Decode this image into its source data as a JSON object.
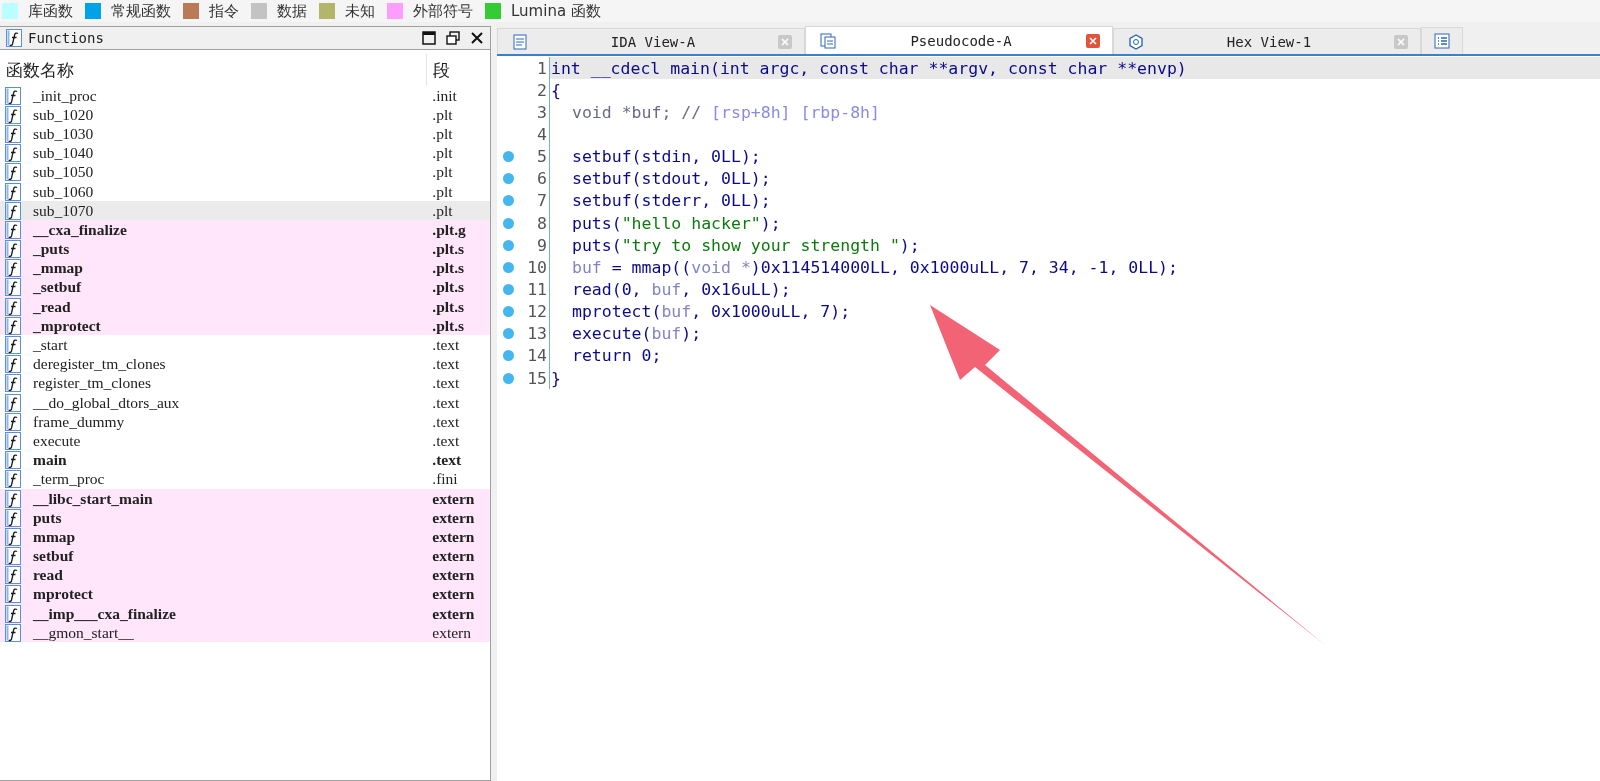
{
  "legend": [
    {
      "label": "库函数",
      "color": "#b9ffff"
    },
    {
      "label": "常规函数",
      "color": "#00a2e8"
    },
    {
      "label": "指令",
      "color": "#b97a57"
    },
    {
      "label": "数据",
      "color": "#c3c3c3"
    },
    {
      "label": "未知",
      "color": "#b5b56a"
    },
    {
      "label": "外部符号",
      "color": "#ff9dff"
    },
    {
      "label": "Lumina 函数",
      "color": "#33cc33"
    }
  ],
  "functions_panel": {
    "title": "Functions",
    "columns": [
      "函数名称",
      "段"
    ],
    "rows": [
      {
        "name": "_init_proc",
        "segment": ".init",
        "kind": "regular",
        "bold": false,
        "selected": false
      },
      {
        "name": "sub_1020",
        "segment": ".plt",
        "kind": "regular",
        "bold": false,
        "selected": false
      },
      {
        "name": "sub_1030",
        "segment": ".plt",
        "kind": "regular",
        "bold": false,
        "selected": false
      },
      {
        "name": "sub_1040",
        "segment": ".plt",
        "kind": "regular",
        "bold": false,
        "selected": false
      },
      {
        "name": "sub_1050",
        "segment": ".plt",
        "kind": "regular",
        "bold": false,
        "selected": false
      },
      {
        "name": "sub_1060",
        "segment": ".plt",
        "kind": "regular",
        "bold": false,
        "selected": false
      },
      {
        "name": "sub_1070",
        "segment": ".plt",
        "kind": "regular",
        "bold": false,
        "selected": true
      },
      {
        "name": "__cxa_finalize",
        "segment": ".plt.g",
        "kind": "external",
        "bold": true,
        "selected": false
      },
      {
        "name": "_puts",
        "segment": ".plt.s",
        "kind": "external",
        "bold": true,
        "selected": false
      },
      {
        "name": "_mmap",
        "segment": ".plt.s",
        "kind": "external",
        "bold": true,
        "selected": false
      },
      {
        "name": "_setbuf",
        "segment": ".plt.s",
        "kind": "external",
        "bold": true,
        "selected": false
      },
      {
        "name": "_read",
        "segment": ".plt.s",
        "kind": "external",
        "bold": true,
        "selected": false
      },
      {
        "name": "_mprotect",
        "segment": ".plt.s",
        "kind": "external",
        "bold": true,
        "selected": false
      },
      {
        "name": "_start",
        "segment": ".text",
        "kind": "regular",
        "bold": false,
        "selected": false
      },
      {
        "name": "deregister_tm_clones",
        "segment": ".text",
        "kind": "regular",
        "bold": false,
        "selected": false
      },
      {
        "name": "register_tm_clones",
        "segment": ".text",
        "kind": "regular",
        "bold": false,
        "selected": false
      },
      {
        "name": "__do_global_dtors_aux",
        "segment": ".text",
        "kind": "regular",
        "bold": false,
        "selected": false
      },
      {
        "name": "frame_dummy",
        "segment": ".text",
        "kind": "regular",
        "bold": false,
        "selected": false
      },
      {
        "name": "execute",
        "segment": ".text",
        "kind": "regular",
        "bold": false,
        "selected": false
      },
      {
        "name": "main",
        "segment": ".text",
        "kind": "regular",
        "bold": true,
        "selected": false
      },
      {
        "name": "_term_proc",
        "segment": ".fini",
        "kind": "regular",
        "bold": false,
        "selected": false
      },
      {
        "name": "__libc_start_main",
        "segment": "extern",
        "kind": "external",
        "bold": true,
        "selected": false
      },
      {
        "name": "puts",
        "segment": "extern",
        "kind": "external",
        "bold": true,
        "selected": false
      },
      {
        "name": "mmap",
        "segment": "extern",
        "kind": "external",
        "bold": true,
        "selected": false
      },
      {
        "name": "setbuf",
        "segment": "extern",
        "kind": "external",
        "bold": true,
        "selected": false
      },
      {
        "name": "read",
        "segment": "extern",
        "kind": "external",
        "bold": true,
        "selected": false
      },
      {
        "name": "mprotect",
        "segment": "extern",
        "kind": "external",
        "bold": true,
        "selected": false
      },
      {
        "name": "__imp___cxa_finalize",
        "segment": "extern",
        "kind": "external",
        "bold": true,
        "selected": false
      },
      {
        "name": "__gmon_start__",
        "segment": "extern",
        "kind": "external",
        "bold": false,
        "selected": false
      }
    ]
  },
  "tabs": [
    {
      "label": "IDA View-A",
      "kind": "disassembly",
      "selected": false
    },
    {
      "label": "Pseudocode-A",
      "kind": "pseudocode",
      "selected": true
    },
    {
      "label": "Hex View-1",
      "kind": "hex",
      "selected": false
    }
  ],
  "code": {
    "lines": [
      {
        "number": "1",
        "breakpoint": false,
        "selected": true,
        "indent": false,
        "tokens": [
          {
            "kind": "plain",
            "text": "int __cdecl main(int argc, const char **argv, const char **envp)"
          }
        ]
      },
      {
        "number": "2",
        "breakpoint": false,
        "selected": false,
        "indent": false,
        "tokens": [
          {
            "kind": "plain",
            "text": "{"
          }
        ]
      },
      {
        "number": "3",
        "breakpoint": false,
        "selected": false,
        "indent": true,
        "tokens": [
          {
            "kind": "decl",
            "text": "void *buf; // "
          },
          {
            "kind": "annotation",
            "text": "[rsp+8h] [rbp-8h]"
          }
        ]
      },
      {
        "number": "4",
        "breakpoint": false,
        "selected": false
      },
      {
        "number": "5",
        "breakpoint": true,
        "selected": false,
        "indent": true,
        "tokens": [
          {
            "kind": "plain",
            "text": "setbuf(stdin, 0LL);"
          }
        ]
      },
      {
        "number": "6",
        "breakpoint": true,
        "selected": false,
        "indent": true,
        "tokens": [
          {
            "kind": "plain",
            "text": "setbuf(stdout, 0LL);"
          }
        ]
      },
      {
        "number": "7",
        "breakpoint": true,
        "selected": false,
        "indent": true,
        "tokens": [
          {
            "kind": "plain",
            "text": "setbuf(stderr, 0LL);"
          }
        ]
      },
      {
        "number": "8",
        "breakpoint": true,
        "selected": false,
        "indent": true,
        "tokens": [
          {
            "kind": "plain",
            "text": "puts("
          },
          {
            "kind": "string",
            "text": "\"hello hacker\""
          },
          {
            "kind": "plain",
            "text": ");"
          }
        ]
      },
      {
        "number": "9",
        "breakpoint": true,
        "selected": false,
        "indent": true,
        "tokens": [
          {
            "kind": "plain",
            "text": "puts("
          },
          {
            "kind": "string",
            "text": "\"try to show your strength \""
          },
          {
            "kind": "plain",
            "text": ");"
          }
        ]
      },
      {
        "number": "10",
        "breakpoint": true,
        "selected": false,
        "indent": true,
        "tokens": [
          {
            "kind": "local",
            "text": "buf"
          },
          {
            "kind": "plain",
            "text": " = mmap(("
          },
          {
            "kind": "local",
            "text": "void *"
          },
          {
            "kind": "plain",
            "text": ")0x114514000LL, 0x1000uLL, 7, 34, -1, 0LL);"
          }
        ]
      },
      {
        "number": "11",
        "breakpoint": true,
        "selected": false,
        "indent": true,
        "tokens": [
          {
            "kind": "plain",
            "text": "read(0, "
          },
          {
            "kind": "local",
            "text": "buf"
          },
          {
            "kind": "plain",
            "text": ", 0x16uLL);"
          }
        ]
      },
      {
        "number": "12",
        "breakpoint": true,
        "selected": false,
        "indent": true,
        "tokens": [
          {
            "kind": "plain",
            "text": "mprotect("
          },
          {
            "kind": "local",
            "text": "buf"
          },
          {
            "kind": "plain",
            "text": ", 0x1000uLL, 7);"
          }
        ]
      },
      {
        "number": "13",
        "breakpoint": true,
        "selected": false,
        "indent": true,
        "tokens": [
          {
            "kind": "plain",
            "text": "execute("
          },
          {
            "kind": "local",
            "text": "buf"
          },
          {
            "kind": "plain",
            "text": ");"
          }
        ]
      },
      {
        "number": "14",
        "breakpoint": true,
        "selected": false,
        "indent": true,
        "tokens": [
          {
            "kind": "plain",
            "text": "return 0;"
          }
        ]
      },
      {
        "number": "15",
        "breakpoint": true,
        "selected": false,
        "indent": false,
        "tokens": [
          {
            "kind": "plain",
            "text": "}"
          }
        ]
      }
    ]
  }
}
